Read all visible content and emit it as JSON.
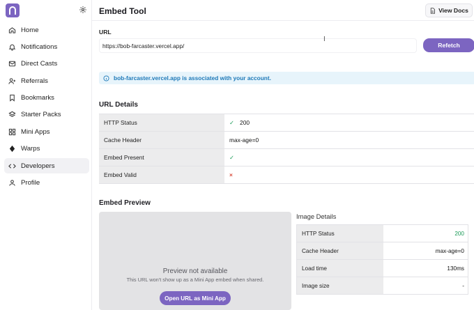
{
  "sidebar": {
    "items": [
      {
        "label": "Home",
        "icon": "home-icon"
      },
      {
        "label": "Notifications",
        "icon": "bell-icon"
      },
      {
        "label": "Direct Casts",
        "icon": "mail-icon"
      },
      {
        "label": "Referrals",
        "icon": "user-plus-icon"
      },
      {
        "label": "Bookmarks",
        "icon": "bookmark-icon"
      },
      {
        "label": "Starter Packs",
        "icon": "layers-icon"
      },
      {
        "label": "Mini Apps",
        "icon": "grid-icon"
      },
      {
        "label": "Warps",
        "icon": "diamond-icon"
      },
      {
        "label": "Developers",
        "icon": "code-icon"
      },
      {
        "label": "Profile",
        "icon": "user-icon"
      }
    ],
    "active": "Developers"
  },
  "header": {
    "title": "Embed Tool",
    "docs_label": "View Docs"
  },
  "url_form": {
    "label": "URL",
    "value": "https://bob-farcaster.vercel.app/",
    "refetch_label": "Refetch"
  },
  "info_banner": {
    "text": "bob-farcaster.vercel.app is associated with your account."
  },
  "url_details": {
    "title": "URL Details",
    "rows": [
      {
        "key": "HTTP Status",
        "value": "200",
        "mark": "✓"
      },
      {
        "key": "Cache Header",
        "value": "max-age=0",
        "mark": ""
      },
      {
        "key": "Embed Present",
        "value": "",
        "mark": "✓"
      },
      {
        "key": "Embed Valid",
        "value": "",
        "mark": "×"
      }
    ]
  },
  "embed_preview": {
    "title": "Embed Preview",
    "unavailable_title": "Preview not available",
    "unavailable_sub": "This URL won't show up as a Mini App embed when shared.",
    "open_button": "Open URL as Mini App"
  },
  "image_details": {
    "title": "Image Details",
    "rows": [
      {
        "key": "HTTP Status",
        "value": "200"
      },
      {
        "key": "Cache Header",
        "value": "max-age=0"
      },
      {
        "key": "Load time",
        "value": "130ms"
      },
      {
        "key": "Image size",
        "value": "-"
      }
    ]
  },
  "colors": {
    "accent": "#7c65c1",
    "success": "#1a9a57",
    "error": "#d94a3a",
    "info": "#1e79b8"
  }
}
